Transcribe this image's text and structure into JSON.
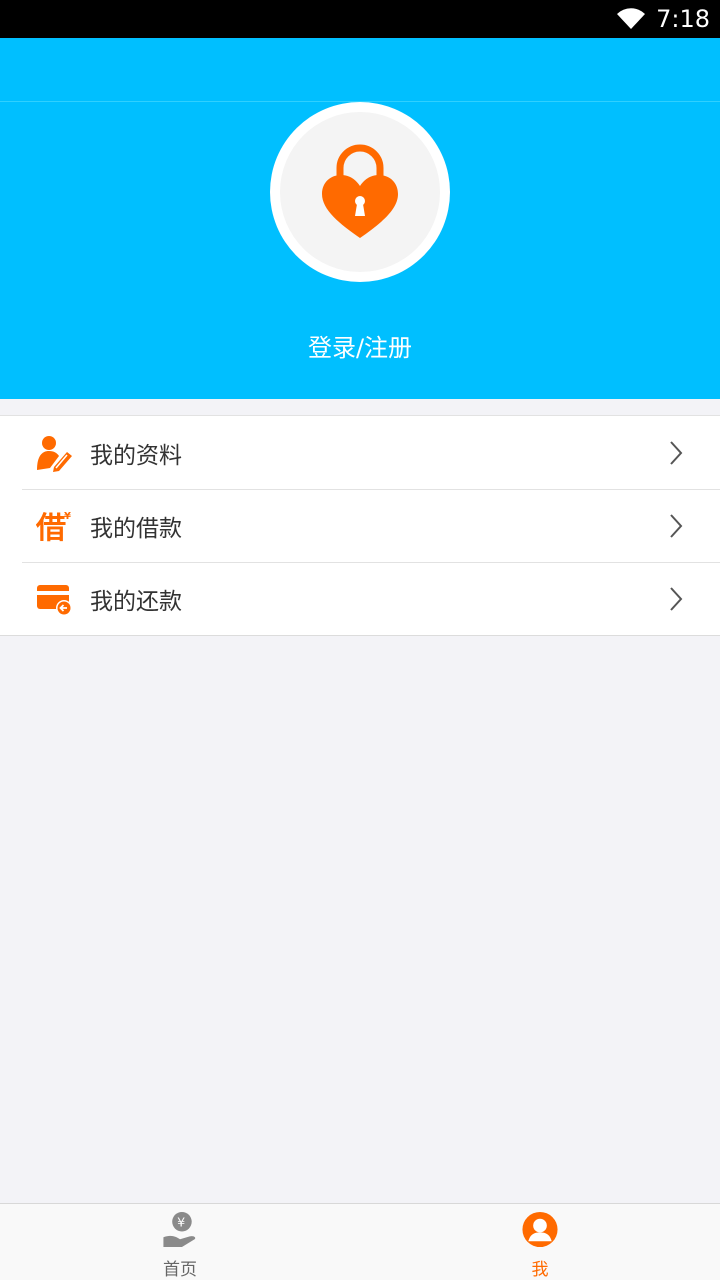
{
  "status_bar": {
    "time": "7:18",
    "wifi_icon": "wifi-icon"
  },
  "header": {
    "avatar_icon": "heart-lock-icon",
    "login_label": "登录/注册"
  },
  "menu": {
    "items": [
      {
        "label": "我的资料",
        "icon": "profile-edit-icon"
      },
      {
        "label": "我的借款",
        "icon": "borrow-icon"
      },
      {
        "label": "我的还款",
        "icon": "repay-card-icon"
      }
    ]
  },
  "tabbar": {
    "tabs": [
      {
        "label": "首页",
        "icon": "yen-hand-icon",
        "active": false
      },
      {
        "label": "我",
        "icon": "user-circle-icon",
        "active": true
      }
    ]
  },
  "colors": {
    "primary": "#00bfff",
    "accent": "#ff6a00",
    "background": "#f3f3f7"
  }
}
